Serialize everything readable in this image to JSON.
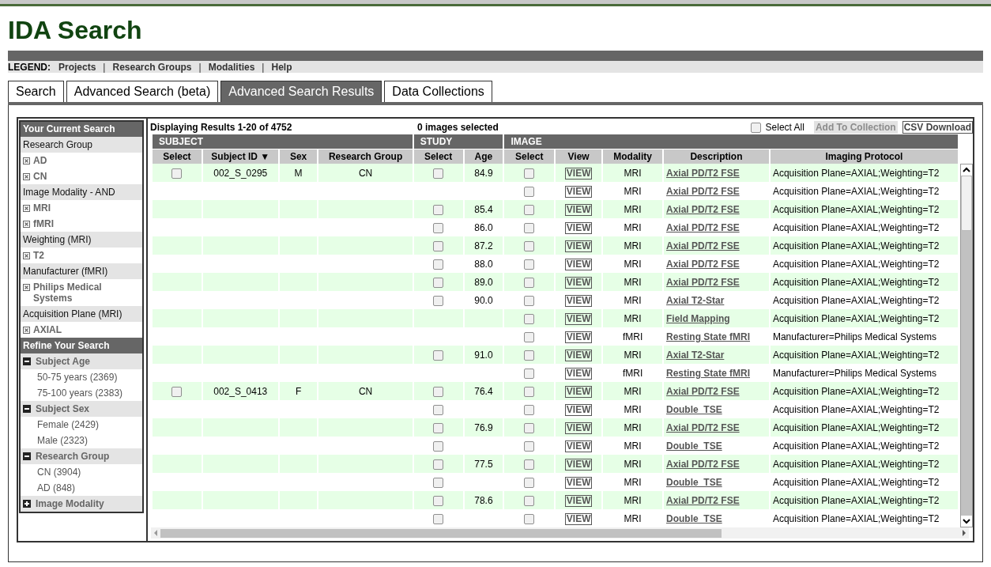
{
  "title": "IDA Search",
  "legend": {
    "label": "LEGEND:",
    "items": [
      {
        "kind": "link",
        "label": "Projects"
      },
      {
        "kind": "separator",
        "label": "|"
      },
      {
        "kind": "link",
        "label": "Research Groups"
      },
      {
        "kind": "separator",
        "label": "|"
      },
      {
        "kind": "link",
        "label": "Modalities"
      },
      {
        "kind": "separator",
        "label": "|"
      },
      {
        "kind": "link",
        "label": "Help"
      }
    ]
  },
  "tabs": [
    {
      "label": "Search",
      "selected": false
    },
    {
      "label": "Advanced Search (beta)",
      "selected": false
    },
    {
      "label": "Advanced Search Results",
      "selected": true
    },
    {
      "label": "Data Collections",
      "selected": false
    }
  ],
  "sidebar": {
    "current": {
      "title": "Your Current Search",
      "items": [
        {
          "kind": "category",
          "label": "Research Group"
        },
        {
          "kind": "filter",
          "label": "AD"
        },
        {
          "kind": "filter",
          "label": "CN"
        },
        {
          "kind": "category",
          "label": "Image Modality - AND"
        },
        {
          "kind": "filter",
          "label": "MRI"
        },
        {
          "kind": "filter",
          "label": "fMRI"
        },
        {
          "kind": "category",
          "label": "Weighting (MRI)"
        },
        {
          "kind": "filter",
          "label": "T2"
        },
        {
          "kind": "category",
          "label": "Manufacturer (fMRI)"
        },
        {
          "kind": "filter",
          "label": "Philips Medical Systems"
        },
        {
          "kind": "category",
          "label": "Acquisition Plane (MRI)"
        },
        {
          "kind": "filter",
          "label": "AXIAL"
        }
      ]
    },
    "refine": {
      "title": "Refine Your Search",
      "groups": [
        {
          "label": "Subject Age",
          "expanded": true,
          "children": [
            {
              "label": "50-75 years (2369)"
            },
            {
              "label": "75-100 years (2383)"
            }
          ]
        },
        {
          "label": "Subject Sex",
          "expanded": true,
          "children": [
            {
              "label": "Female (2429)"
            },
            {
              "label": "Male (2323)"
            }
          ]
        },
        {
          "label": "Research Group",
          "expanded": true,
          "children": [
            {
              "label": "CN (3904)"
            },
            {
              "label": "AD (848)"
            }
          ]
        },
        {
          "label": "Image Modality",
          "expanded": false
        }
      ]
    }
  },
  "results": {
    "summary": "Displaying Results 1-20 of 4752",
    "selected_count": "0 images selected",
    "select_all": {
      "label": "Select All",
      "checked": false
    },
    "buttons": [
      {
        "label": "Add To Collection",
        "disabled": true
      },
      {
        "label": "CSV Download",
        "disabled": false
      }
    ],
    "groups": [
      {
        "label": "SUBJECT",
        "columns": [
          "Select",
          "Subject ID ▼",
          "Sex",
          "Research Group"
        ]
      },
      {
        "label": "STUDY",
        "columns": [
          "Select",
          "Age"
        ]
      },
      {
        "label": "IMAGE",
        "columns": [
          "Select",
          "View",
          "Modality",
          "Description",
          "Imaging Protocol"
        ]
      }
    ],
    "rows": [
      {
        "subject_select": false,
        "subject_id": "002_S_0295",
        "sex": "M",
        "group": "CN",
        "study_select": false,
        "age": "84.9",
        "image_select": false,
        "view": "VIEW",
        "modality": "MRI",
        "description": "Axial PD/T2 FSE",
        "protocol": "Acquisition Plane=AXIAL;Weighting=T2"
      },
      {
        "image_select": false,
        "view": "VIEW",
        "modality": "MRI",
        "description": "Axial PD/T2 FSE",
        "protocol": "Acquisition Plane=AXIAL;Weighting=T2"
      },
      {
        "study_select": false,
        "age": "85.4",
        "image_select": false,
        "view": "VIEW",
        "modality": "MRI",
        "description": "Axial PD/T2 FSE",
        "protocol": "Acquisition Plane=AXIAL;Weighting=T2"
      },
      {
        "study_select": false,
        "age": "86.0",
        "image_select": false,
        "view": "VIEW",
        "modality": "MRI",
        "description": "Axial PD/T2 FSE",
        "protocol": "Acquisition Plane=AXIAL;Weighting=T2"
      },
      {
        "study_select": false,
        "age": "87.2",
        "image_select": false,
        "view": "VIEW",
        "modality": "MRI",
        "description": "Axial PD/T2 FSE",
        "protocol": "Acquisition Plane=AXIAL;Weighting=T2"
      },
      {
        "study_select": false,
        "age": "88.0",
        "image_select": false,
        "view": "VIEW",
        "modality": "MRI",
        "description": "Axial PD/T2 FSE",
        "protocol": "Acquisition Plane=AXIAL;Weighting=T2"
      },
      {
        "study_select": false,
        "age": "89.0",
        "image_select": false,
        "view": "VIEW",
        "modality": "MRI",
        "description": "Axial PD/T2 FSE",
        "protocol": "Acquisition Plane=AXIAL;Weighting=T2"
      },
      {
        "study_select": false,
        "age": "90.0",
        "image_select": false,
        "view": "VIEW",
        "modality": "MRI",
        "description": "Axial T2-Star",
        "protocol": "Acquisition Plane=AXIAL;Weighting=T2"
      },
      {
        "image_select": false,
        "view": "VIEW",
        "modality": "MRI",
        "description": "Field Mapping",
        "protocol": "Acquisition Plane=AXIAL;Weighting=T2"
      },
      {
        "image_select": false,
        "view": "VIEW",
        "modality": "fMRI",
        "description": "Resting State fMRI",
        "protocol": "Manufacturer=Philips Medical Systems"
      },
      {
        "study_select": false,
        "age": "91.0",
        "image_select": false,
        "view": "VIEW",
        "modality": "MRI",
        "description": "Axial T2-Star",
        "protocol": "Acquisition Plane=AXIAL;Weighting=T2"
      },
      {
        "image_select": false,
        "view": "VIEW",
        "modality": "fMRI",
        "description": "Resting State fMRI",
        "protocol": "Manufacturer=Philips Medical Systems"
      },
      {
        "subject_select": false,
        "subject_id": "002_S_0413",
        "sex": "F",
        "group": "CN",
        "study_select": false,
        "age": "76.4",
        "image_select": false,
        "view": "VIEW",
        "modality": "MRI",
        "description": "Axial PD/T2 FSE",
        "protocol": "Acquisition Plane=AXIAL;Weighting=T2"
      },
      {
        "study_select": false,
        "image_select": false,
        "view": "VIEW",
        "modality": "MRI",
        "description": "Double_TSE",
        "protocol": "Acquisition Plane=AXIAL;Weighting=T2"
      },
      {
        "study_select": false,
        "age": "76.9",
        "image_select": false,
        "view": "VIEW",
        "modality": "MRI",
        "description": "Axial PD/T2 FSE",
        "protocol": "Acquisition Plane=AXIAL;Weighting=T2"
      },
      {
        "study_select": false,
        "image_select": false,
        "view": "VIEW",
        "modality": "MRI",
        "description": "Double_TSE",
        "protocol": "Acquisition Plane=AXIAL;Weighting=T2"
      },
      {
        "study_select": false,
        "age": "77.5",
        "image_select": false,
        "view": "VIEW",
        "modality": "MRI",
        "description": "Axial PD/T2 FSE",
        "protocol": "Acquisition Plane=AXIAL;Weighting=T2"
      },
      {
        "study_select": false,
        "image_select": false,
        "view": "VIEW",
        "modality": "MRI",
        "description": "Double_TSE",
        "protocol": "Acquisition Plane=AXIAL;Weighting=T2"
      },
      {
        "study_select": false,
        "age": "78.6",
        "image_select": false,
        "view": "VIEW",
        "modality": "MRI",
        "description": "Axial PD/T2 FSE",
        "protocol": "Acquisition Plane=AXIAL;Weighting=T2"
      },
      {
        "study_select": false,
        "image_select": false,
        "view": "VIEW",
        "modality": "MRI",
        "description": "Double_TSE",
        "protocol": "Acquisition Plane=AXIAL;Weighting=T2"
      }
    ]
  }
}
